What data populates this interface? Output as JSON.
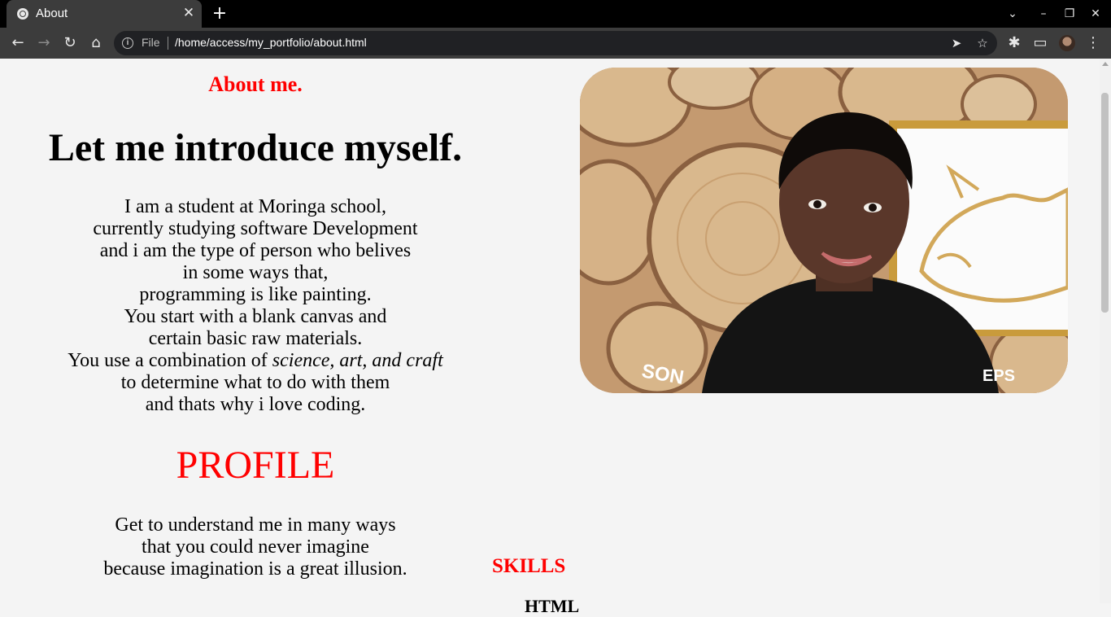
{
  "browser": {
    "tab_title": "About",
    "close_symbol": "✕",
    "new_tab_symbol": "+",
    "file_label": "File",
    "url": "/home/access/my_portfolio/about.html",
    "icons": [
      "globe-icon",
      "close-icon",
      "plus-icon",
      "chevron-down-icon",
      "minimize-icon",
      "restore-icon",
      "close-window-icon",
      "back-icon",
      "forward-icon",
      "reload-icon",
      "home-icon",
      "info-icon",
      "send-icon",
      "star-icon",
      "puzzle-icon",
      "cast-icon",
      "more-icon"
    ]
  },
  "about": {
    "label": "About me.",
    "heading": "Let me introduce myself.",
    "bio_lines": [
      "I am a student at Moringa school,",
      "currently studying software Development",
      "and i am the type of person who belives",
      "in some ways that,",
      "programming is like painting.",
      "You start with a blank canvas and",
      "certain basic raw materials."
    ],
    "combo_prefix": "You use a combination of ",
    "combo_emphasis": "science, art, and craft",
    "bio_end_lines": [
      "to determine what to do with them",
      "and thats why i love coding."
    ]
  },
  "profile": {
    "heading": "PROFILE",
    "lines": [
      "Get to understand me in many ways",
      "that you could never imagine",
      "because imagination is a great illusion."
    ]
  },
  "skills": {
    "heading": "SKILLS",
    "first_item": "HTML"
  },
  "colors": {
    "accent": "#ff0000",
    "page_background": "#f4f4f4"
  }
}
